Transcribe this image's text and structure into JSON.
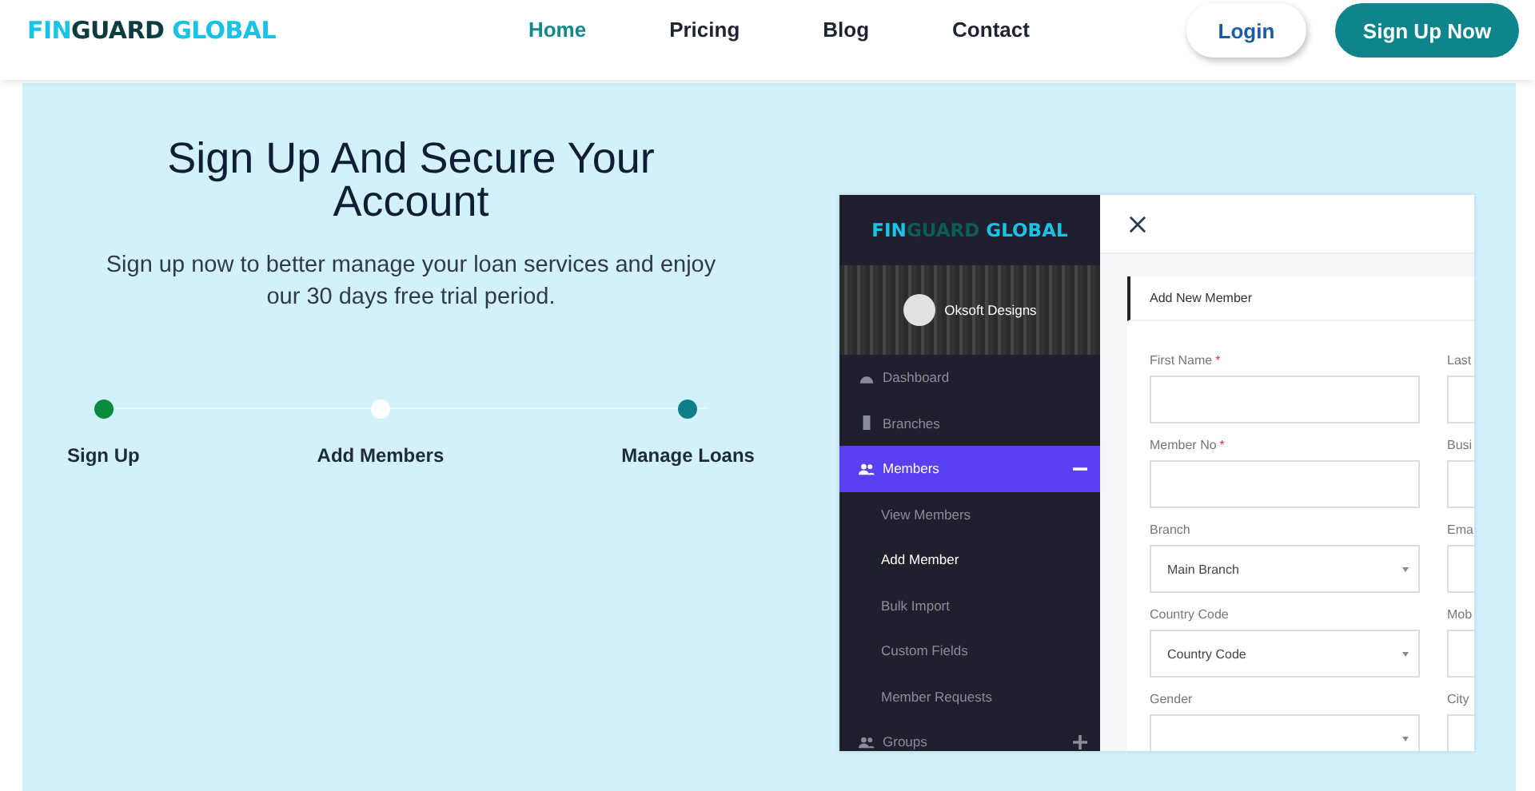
{
  "header": {
    "logo": [
      {
        "text": "FIN",
        "kind": "accent"
      },
      {
        "text": "GUARD",
        "kind": "base"
      },
      {
        "text": " GLOBAL",
        "kind": "accent"
      }
    ],
    "nav": [
      {
        "label": "Home",
        "selected": true
      },
      {
        "label": "Pricing",
        "selected": false
      },
      {
        "label": "Blog",
        "selected": false
      },
      {
        "label": "Contact",
        "selected": false
      }
    ],
    "login": "Login",
    "signup": "Sign Up Now"
  },
  "hero": {
    "title": "Sign Up And Secure Your Account",
    "subtitle": "Sign up now to better manage your loan services and enjoy our 30 days free trial period.",
    "steps": [
      {
        "label": "Sign Up",
        "color": "#0a8a3c"
      },
      {
        "label": "Add Members",
        "color": "#ffffff"
      },
      {
        "label": "Manage Loans",
        "color": "#0e7f88"
      }
    ]
  },
  "app": {
    "logo": [
      {
        "text": "FIN",
        "kind": "accent"
      },
      {
        "text": "GUARD",
        "kind": "base"
      },
      {
        "text": " GLOBAL",
        "kind": "accent"
      }
    ],
    "user": "Oksoft Designs",
    "menu": [
      {
        "label": "Dashboard",
        "kind": "gauge",
        "selected": false
      },
      {
        "label": "Branches",
        "kind": "building",
        "selected": false
      },
      {
        "label": "Members",
        "kind": "people",
        "selected": true,
        "expanded": true,
        "children": [
          {
            "label": "View Members",
            "selected": false
          },
          {
            "label": "Add Member",
            "selected": true
          },
          {
            "label": "Bulk Import",
            "selected": false
          },
          {
            "label": "Custom Fields",
            "selected": false
          },
          {
            "label": "Member Requests",
            "selected": false
          }
        ]
      },
      {
        "label": "Groups",
        "kind": "people",
        "selected": false,
        "expanded": false
      }
    ],
    "panel_title": "Add New Member",
    "fields": [
      [
        {
          "label": "First Name",
          "required_mark": "*",
          "kind": "text"
        },
        {
          "label": "Last",
          "kind": "text"
        }
      ],
      [
        {
          "label": "Member No",
          "required_mark": "*",
          "kind": "text"
        },
        {
          "label": "Busi",
          "kind": "text"
        }
      ],
      [
        {
          "label": "Branch",
          "kind": "select",
          "value": "Main Branch"
        },
        {
          "label": "Ema",
          "kind": "text"
        }
      ],
      [
        {
          "label": "Country Code",
          "kind": "select",
          "value": "Country Code"
        },
        {
          "label": "Mob",
          "kind": "text"
        }
      ],
      [
        {
          "label": "Gender",
          "kind": "select"
        },
        {
          "label": "City",
          "kind": "text"
        }
      ]
    ]
  }
}
